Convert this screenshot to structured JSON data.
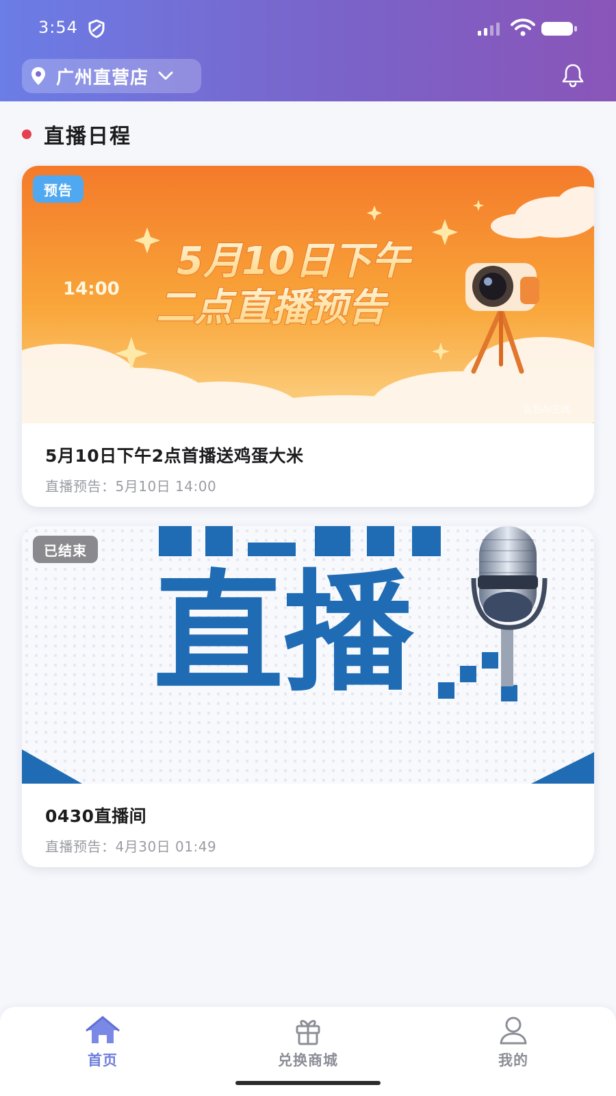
{
  "status_bar": {
    "time": "3:54"
  },
  "header": {
    "store_name": "广州直营店"
  },
  "section": {
    "title": "直播日程"
  },
  "cards": [
    {
      "badge": "预告",
      "title": "5月10日下午2点首播送鸡蛋大米",
      "meta": "直播预告：5月10日 14:00",
      "banner": {
        "line1": "5月10日下午",
        "line2": "二点直播预告",
        "time": "14:00",
        "watermark": "豆包AI生成"
      }
    },
    {
      "badge": "已结束",
      "title": "0430直播间",
      "meta": "直播预告：4月30日 01:49",
      "banner": {
        "big_text": "直播"
      }
    }
  ],
  "bottom_nav": {
    "items": [
      {
        "label": "首页",
        "icon": "home-icon",
        "active": true
      },
      {
        "label": "兑换商城",
        "icon": "gift-icon",
        "active": false
      },
      {
        "label": "我的",
        "icon": "user-icon",
        "active": false
      }
    ]
  },
  "colors": {
    "header_start": "#6b7de6",
    "header_end": "#8a55b8",
    "accent": "#6d7ddc",
    "section_dot": "#e5404f",
    "badge_preview": "#4fa8f0",
    "badge_ended": "#8a8a8e"
  }
}
